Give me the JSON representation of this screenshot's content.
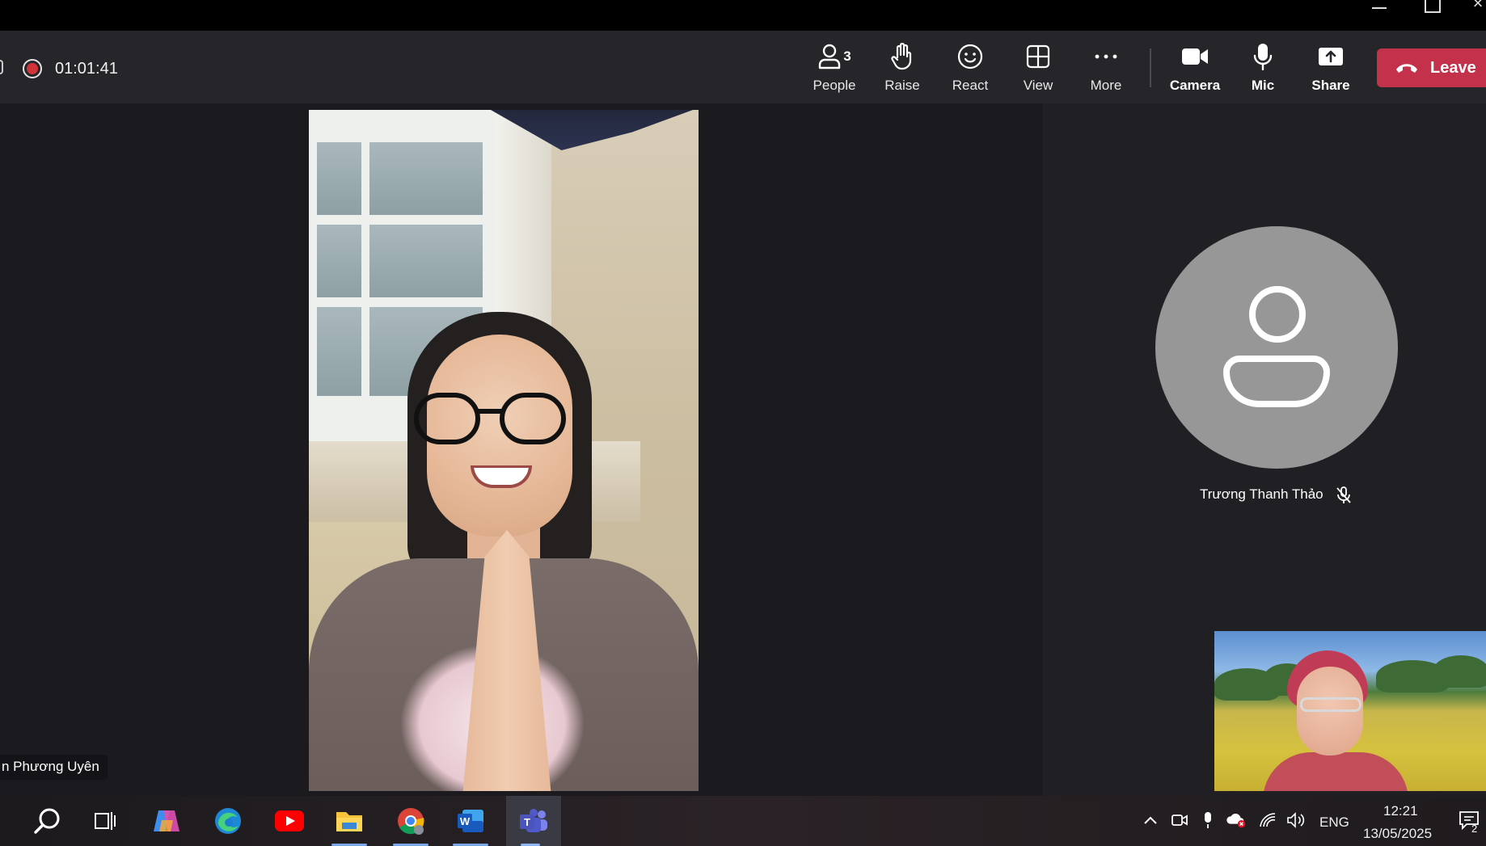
{
  "window": {
    "minimize_icon": "minimize-icon",
    "maximize_icon": "restore-icon",
    "close_glyph": "×"
  },
  "meeting": {
    "recording_icon": "record-icon",
    "timer": "01:01:41"
  },
  "toolbar": {
    "people": {
      "label": "People",
      "count": "3"
    },
    "raise": {
      "label": "Raise"
    },
    "react": {
      "label": "React"
    },
    "view": {
      "label": "View"
    },
    "more": {
      "label": "More"
    },
    "camera": {
      "label": "Camera"
    },
    "mic": {
      "label": "Mic"
    },
    "share": {
      "label": "Share"
    },
    "leave": {
      "label": "Leave"
    }
  },
  "participants": {
    "main_video_name": "n Phương Uyên",
    "avatar_name": "Trương Thanh Thảo"
  },
  "taskbar": {
    "apps": [
      "search",
      "task-view",
      "copilot",
      "edge",
      "youtube",
      "file-explorer",
      "chrome",
      "word",
      "teams"
    ],
    "language": "ENG",
    "time": "12:21",
    "date": "13/05/2025",
    "notification_count": "2"
  },
  "colors": {
    "leave": "#c4314b",
    "record": "#d13438",
    "toolbar_bg": "#26252a",
    "stage_bg": "#1b1a1e"
  }
}
